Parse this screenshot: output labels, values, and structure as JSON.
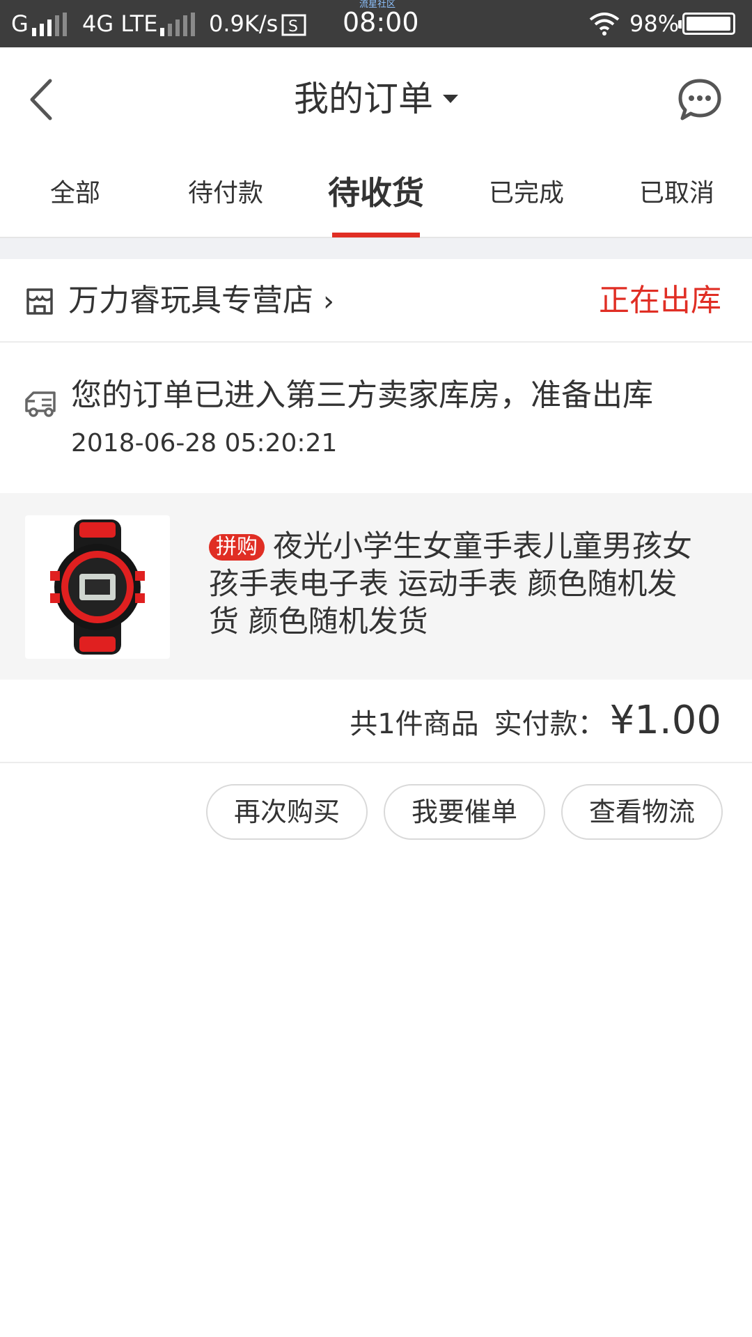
{
  "status_bar": {
    "carrier1": "G",
    "carrier2": "4G LTE",
    "speed": "0.9K/s",
    "time": "08:00",
    "small_label": "流星社区",
    "battery": "98%",
    "battery_level": 0.98
  },
  "header": {
    "title": "我的订单",
    "back_icon": "chevron-left-icon",
    "message_icon": "chat-bubble-icon"
  },
  "tabs": [
    {
      "label": "全部",
      "active": false
    },
    {
      "label": "待付款",
      "active": false
    },
    {
      "label": "待收货",
      "active": true
    },
    {
      "label": "已完成",
      "active": false
    },
    {
      "label": "已取消",
      "active": false
    }
  ],
  "order": {
    "store_name": "万力睿玩具专营店",
    "chevron": "›",
    "status": "正在出库",
    "logistics_text": "您的订单已进入第三方卖家库房，准备出库",
    "logistics_time": "2018-06-28 05:20:21",
    "product": {
      "tag": "拼购",
      "title": "夜光小学生女童手表儿童男孩女孩手表电子表 运动手表 颜色随机发货 颜色随机发货"
    },
    "summary_count": "共1件商品",
    "summary_paid_label": "实付款：",
    "summary_amount": "¥1.00",
    "buttons": {
      "buy_again": "再次购买",
      "urge": "我要催单",
      "logistics": "查看物流"
    }
  },
  "colors": {
    "accent": "#e02e24",
    "status_bar": "#3d3d3d",
    "product_bg": "#f5f5f5"
  }
}
